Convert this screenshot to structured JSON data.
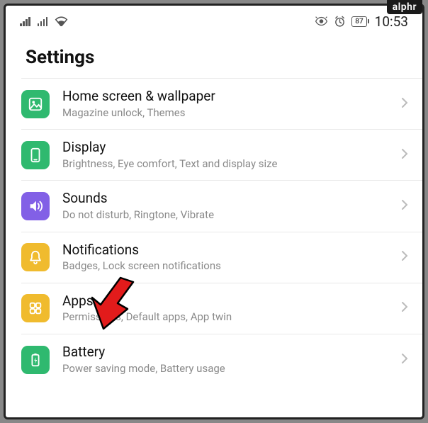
{
  "watermark": "alphr",
  "status": {
    "battery_pct": "87",
    "time": "10:53"
  },
  "title": "Settings",
  "items": [
    {
      "icon": "home-wallpaper-icon",
      "color": "#2fb96f",
      "title": "Home screen & wallpaper",
      "subtitle": "Magazine unlock, Themes"
    },
    {
      "icon": "display-icon",
      "color": "#2fb96f",
      "title": "Display",
      "subtitle": "Brightness, Eye comfort, Text and display size"
    },
    {
      "icon": "sound-icon",
      "color": "#8260e6",
      "title": "Sounds",
      "subtitle": "Do not disturb, Ringtone, Vibrate"
    },
    {
      "icon": "bell-icon",
      "color": "#f0bb2e",
      "title": "Notifications",
      "subtitle": "Badges, Lock screen notifications"
    },
    {
      "icon": "apps-grid-icon",
      "color": "#f0bb2e",
      "title": "Apps",
      "subtitle": "Permissions, Default apps, App twin"
    },
    {
      "icon": "battery-icon",
      "color": "#2fb96f",
      "title": "Battery",
      "subtitle": "Power saving mode, Battery usage"
    }
  ]
}
